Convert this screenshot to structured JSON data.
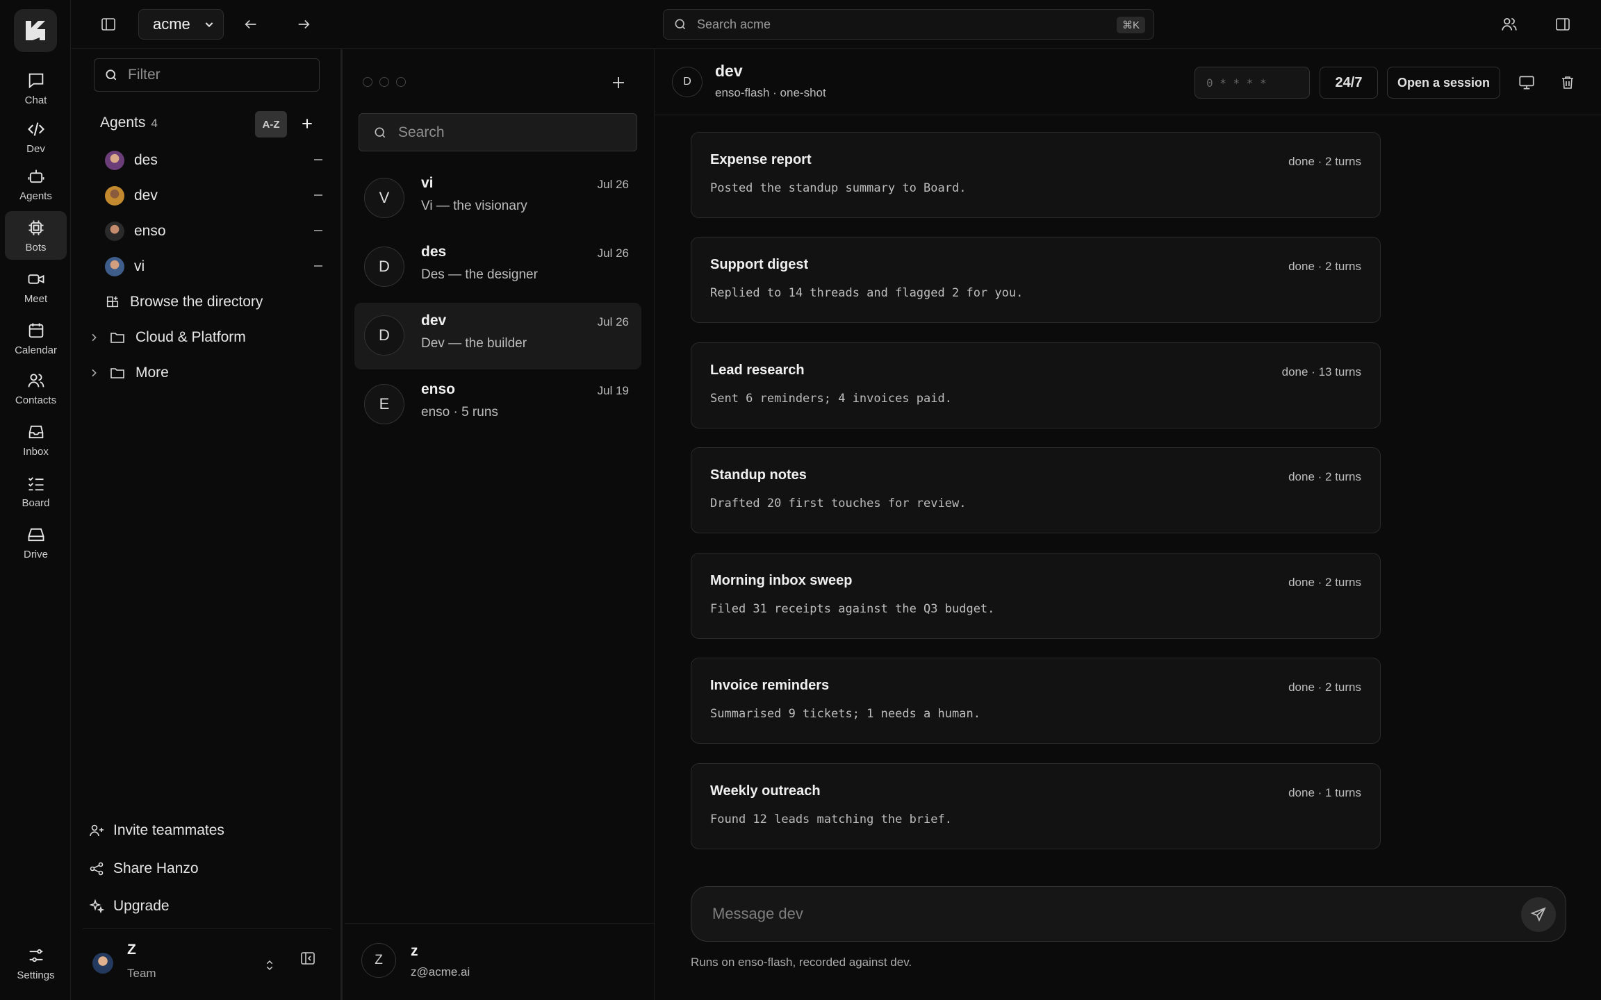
{
  "rail": {
    "items": [
      {
        "label": "Chat",
        "icon": "chat-icon"
      },
      {
        "label": "Dev",
        "icon": "code-icon"
      },
      {
        "label": "Agents",
        "icon": "robot-icon"
      },
      {
        "label": "Bots",
        "icon": "chip-icon",
        "active": true
      },
      {
        "label": "Meet",
        "icon": "video-icon"
      },
      {
        "label": "Calendar",
        "icon": "calendar-icon"
      },
      {
        "label": "Contacts",
        "icon": "contacts-icon"
      },
      {
        "label": "Inbox",
        "icon": "inbox-icon"
      },
      {
        "label": "Board",
        "icon": "checklist-icon"
      },
      {
        "label": "Drive",
        "icon": "drive-icon"
      }
    ],
    "settings_label": "Settings"
  },
  "topbar": {
    "workspace": "acme",
    "search_placeholder": "Search acme",
    "search_shortcut": "⌘K"
  },
  "sidebar": {
    "filter_placeholder": "Filter",
    "agents_label": "Agents",
    "agents_count": "4",
    "sort_label": "A-Z",
    "agents": [
      {
        "name": "des"
      },
      {
        "name": "dev"
      },
      {
        "name": "enso"
      },
      {
        "name": "vi"
      }
    ],
    "browse_label": "Browse the directory",
    "folders": [
      {
        "label": "Cloud & Platform"
      },
      {
        "label": "More"
      }
    ],
    "links": {
      "invite": "Invite teammates",
      "share": "Share Hanzo",
      "upgrade": "Upgrade"
    },
    "user": {
      "name": "Z",
      "role": "Team"
    }
  },
  "conversations": {
    "search_placeholder": "Search",
    "items": [
      {
        "initial": "V",
        "name": "vi",
        "date": "Jul 26",
        "subtitle": "Vi — the visionary"
      },
      {
        "initial": "D",
        "name": "des",
        "date": "Jul 26",
        "subtitle": "Des — the designer"
      },
      {
        "initial": "D",
        "name": "dev",
        "date": "Jul 26",
        "subtitle": "Dev — the builder",
        "active": true
      },
      {
        "initial": "E",
        "name": "enso",
        "date": "Jul 19",
        "subtitle": "enso · 5 runs"
      }
    ],
    "me": {
      "initial": "Z",
      "name": "z",
      "email": "z@acme.ai"
    }
  },
  "main": {
    "avatar_initial": "D",
    "title": "dev",
    "subtitle": "enso-flash · one-shot",
    "token_mask": "0 * * * *",
    "schedule_label": "24/7",
    "open_session_label": "Open a session",
    "runs": [
      {
        "title": "Expense report",
        "meta": "done · 2 turns",
        "body": "Posted the standup summary to Board."
      },
      {
        "title": "Support digest",
        "meta": "done · 2 turns",
        "body": "Replied to 14 threads and flagged 2 for you."
      },
      {
        "title": "Lead research",
        "meta": "done · 13 turns",
        "body": "Sent 6 reminders; 4 invoices paid."
      },
      {
        "title": "Standup notes",
        "meta": "done · 2 turns",
        "body": "Drafted 20 first touches for review."
      },
      {
        "title": "Morning inbox sweep",
        "meta": "done · 2 turns",
        "body": "Filed 31 receipts against the Q3 budget."
      },
      {
        "title": "Invoice reminders",
        "meta": "done · 2 turns",
        "body": "Summarised 9 tickets; 1 needs a human."
      },
      {
        "title": "Weekly outreach",
        "meta": "done · 1 turns",
        "body": "Found 12 leads matching the brief."
      }
    ],
    "composer_placeholder": "Message dev",
    "footnote": "Runs on enso-flash, recorded against dev."
  }
}
